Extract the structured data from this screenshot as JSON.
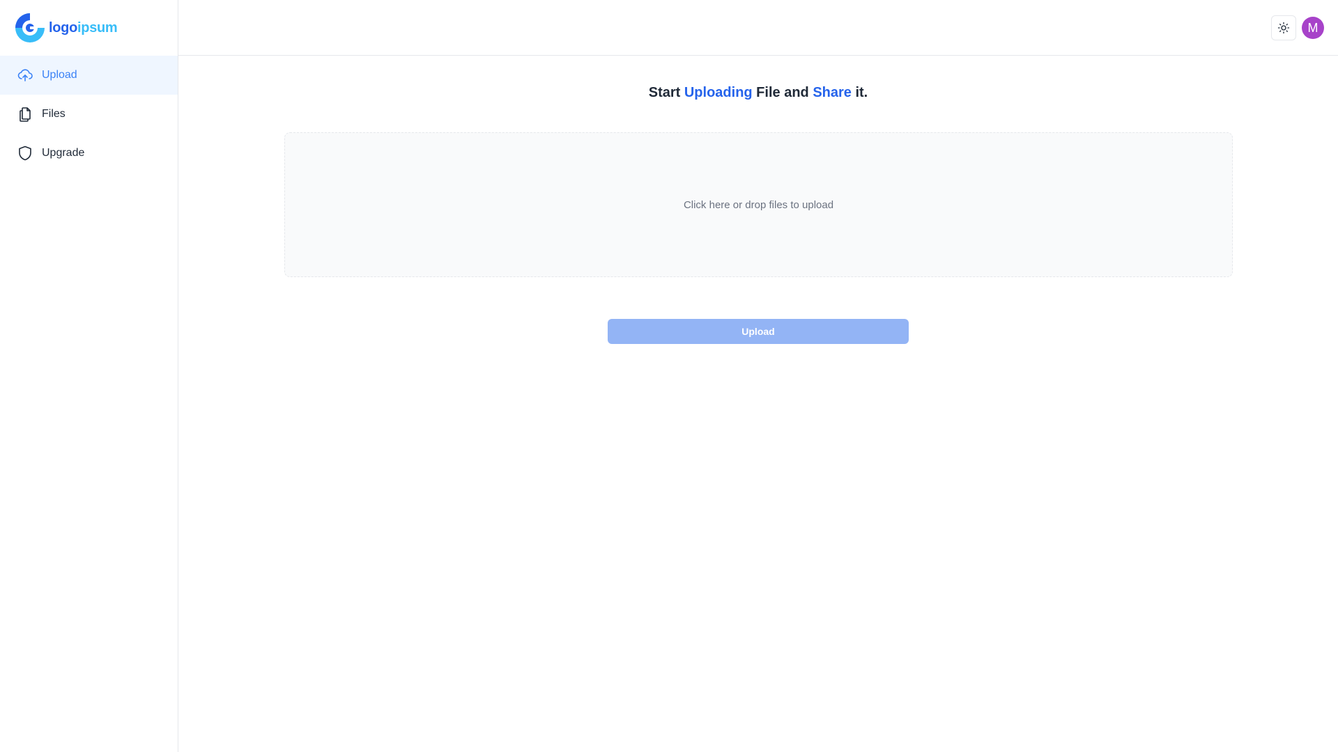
{
  "brand": {
    "logo_text_part1": "logo",
    "logo_text_part2": "ipsum",
    "logo_icon": "logo-icon"
  },
  "sidebar": {
    "items": [
      {
        "label": "Upload",
        "icon": "cloud-upload-icon",
        "active": true
      },
      {
        "label": "Files",
        "icon": "files-icon",
        "active": false
      },
      {
        "label": "Upgrade",
        "icon": "shield-icon",
        "active": false
      }
    ]
  },
  "header": {
    "theme_toggle_icon": "sun-icon",
    "avatar_initial": "M"
  },
  "main": {
    "headline": {
      "part1": "Start ",
      "accent1": "Uploading",
      "part2": " File and ",
      "accent2": "Share",
      "part3": " it."
    },
    "dropzone_text": "Click here or drop files to upload",
    "upload_button_label": "Upload"
  },
  "colors": {
    "accent": "#2563eb",
    "accent_light": "#38bdf8",
    "active_nav_bg": "#eff6ff",
    "button_disabled": "#93b4f5",
    "avatar": "#a742c9"
  }
}
